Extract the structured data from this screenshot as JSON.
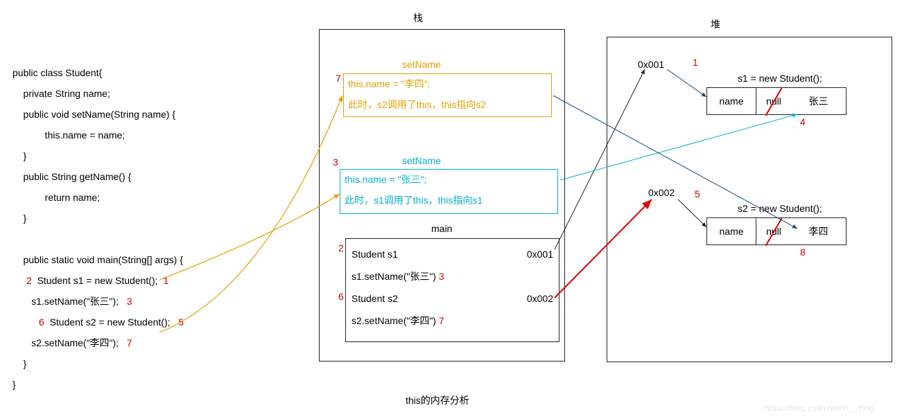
{
  "stack_title": "栈",
  "heap_title": "堆",
  "footer": "this的内存分析",
  "watermark": "https://blog.csdn.net/Yi__Ying",
  "code": {
    "l1": "public class Student{",
    "l2": "    private String name;",
    "l3": "    public void setName(String name) {",
    "l4": "            this.name = name;",
    "l5": "    }",
    "l6": "    public String getName() {",
    "l7": "            return name;",
    "l8": "    }",
    "l9": "",
    "l10": "    public static void main(String[] args) {",
    "l11_num": "2",
    "l11": "  Student s1 = new Student();",
    "l11_r": "1",
    "l12": "       s1.setName(\"张三\");",
    "l12_r": "3",
    "l13_num": "6",
    "l13": "  Student s2 = new Student();",
    "l13_r": "5",
    "l14": "       s2.setName(\"李四\");",
    "l14_r": "7",
    "l15": "    }",
    "l16": "}"
  },
  "stack": {
    "setName_top": {
      "title": "setName",
      "line1": "this.name = \"李四\";",
      "line2": "此时，s2调用了this，this指向s2",
      "num": "7"
    },
    "setName_bot": {
      "title": "setName",
      "line1": "this.name = \"张三\";",
      "line2": "此时，s1调用了this，this指向s1",
      "num": "3"
    },
    "main": {
      "title": "main",
      "r1a": "Student s1",
      "r1b": "0x001",
      "r1n": "2",
      "r2a": "s1.setName(\"张三\")",
      "r2n": "3",
      "r3a": "Student s2",
      "r3b": "0x002",
      "r3n": "6",
      "r4a": "s2.setName(\"李四\")",
      "r4n": "7"
    }
  },
  "heap": {
    "addr1": "0x001",
    "addr1_num": "1",
    "obj1_label": "s1 = new Student();",
    "obj1_k": "name",
    "obj1_null": "null",
    "obj1_v": "张三",
    "obj1_num": "4",
    "addr2": "0x002",
    "addr2_num": "5",
    "obj2_label": "s2 = new Student();",
    "obj2_k": "name",
    "obj2_null": "null",
    "obj2_v": "李四",
    "obj2_num": "8"
  }
}
